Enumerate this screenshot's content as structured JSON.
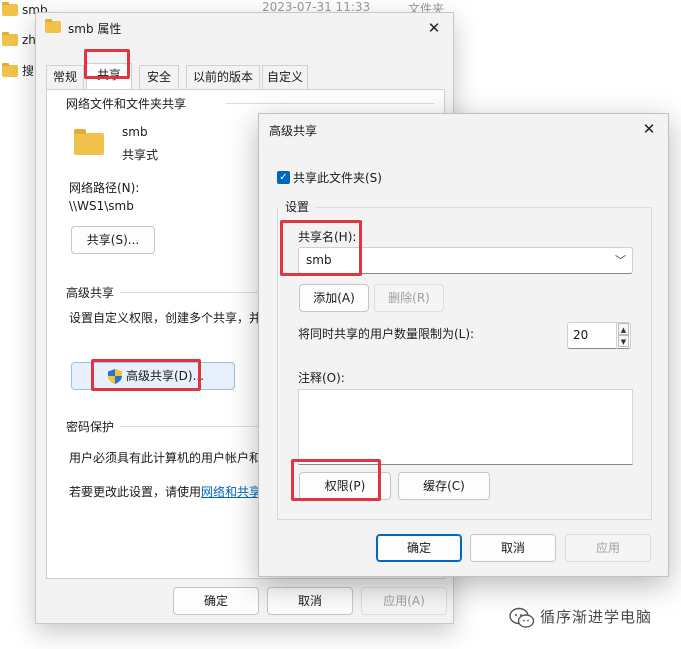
{
  "background": {
    "files": [
      {
        "name": "smb"
      },
      {
        "name": "zh"
      },
      {
        "name": "搜"
      }
    ],
    "date_header": "2023-07-31 11:33",
    "type_header": "文件夹"
  },
  "properties": {
    "title": "smb 属性",
    "tabs": [
      "常规",
      "共享",
      "安全",
      "以前的版本",
      "自定义"
    ],
    "active_tab": "共享",
    "network_group_title": "网络文件和文件夹共享",
    "folder_name": "smb",
    "share_state": "共享式",
    "network_path_label": "网络路径(N):",
    "network_path_value": "\\\\WS1\\smb",
    "share_button": "共享(S)...",
    "advanced_group_title": "高级共享",
    "advanced_desc": "设置自定义权限，创建多个共享，并",
    "advanced_button": "高级共享(D)...",
    "password_group_title": "密码保护",
    "password_desc": "用户必须具有此计算机的用户帐户和",
    "password_change_prefix": "若要更改此设置，请使用",
    "password_change_link": "网络和共享",
    "ok": "确定",
    "cancel": "取消",
    "apply": "应用(A)"
  },
  "advanced_dialog": {
    "title": "高级共享",
    "share_checkbox_label": "共享此文件夹(S)",
    "share_checked": true,
    "settings_group": "设置",
    "share_name_label": "共享名(H):",
    "share_name_value": "smb",
    "add_button": "添加(A)",
    "remove_button": "删除(R)",
    "limit_label": "将同时共享的用户数量限制为(L):",
    "limit_value": "20",
    "comment_label": "注释(O):",
    "comment_value": "",
    "permissions_button": "权限(P)",
    "caching_button": "缓存(C)",
    "ok": "确定",
    "cancel": "取消",
    "apply": "应用"
  },
  "watermark": "循序渐进学电脑",
  "colors": {
    "highlight": "#e0343e",
    "accent": "#0067c0",
    "folder": "#f0c24b"
  },
  "icons": {
    "close": "close-icon",
    "folder": "folder-icon",
    "shield": "uac-shield-icon",
    "chevron": "chevron-down-icon",
    "wechat": "wechat-icon"
  }
}
